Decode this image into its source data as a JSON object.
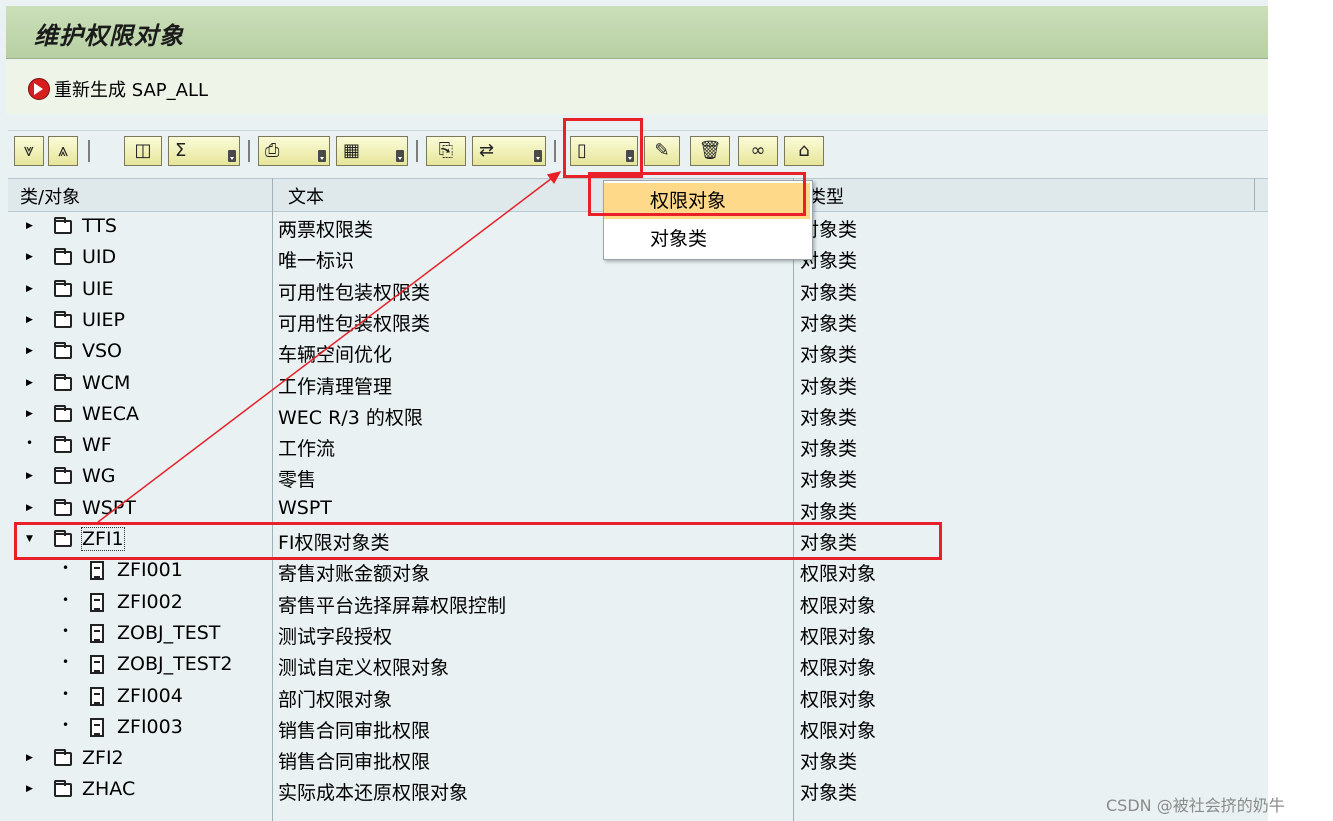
{
  "window": {
    "title": "维护权限对象"
  },
  "app_toolbar": {
    "regen_label": "重新生成 SAP_ALL"
  },
  "columns": {
    "object": "类/对象",
    "text": "文本",
    "type": "类型"
  },
  "dropdown": {
    "items": [
      {
        "label": "权限对象",
        "selected": true
      },
      {
        "label": "对象类",
        "selected": false
      }
    ]
  },
  "rows": [
    {
      "name": "TTS",
      "text": "两票权限类",
      "type": "对象类",
      "kind": "class",
      "toggle": "collapsed"
    },
    {
      "name": "UID",
      "text": "唯一标识",
      "type": "对象类",
      "kind": "class",
      "toggle": "collapsed"
    },
    {
      "name": "UIE",
      "text": "可用性包装权限类",
      "type": "对象类",
      "kind": "class",
      "toggle": "collapsed"
    },
    {
      "name": "UIEP",
      "text": "可用性包装权限类",
      "type": "对象类",
      "kind": "class",
      "toggle": "collapsed"
    },
    {
      "name": "VSO",
      "text": "车辆空间优化",
      "type": "对象类",
      "kind": "class",
      "toggle": "collapsed"
    },
    {
      "name": "WCM",
      "text": "工作清理管理",
      "type": "对象类",
      "kind": "class",
      "toggle": "collapsed"
    },
    {
      "name": "WECA",
      "text": "WEC R/3 的权限",
      "type": "对象类",
      "kind": "class",
      "toggle": "collapsed"
    },
    {
      "name": "WF",
      "text": "工作流",
      "type": "对象类",
      "kind": "class",
      "toggle": "leaf"
    },
    {
      "name": "WG",
      "text": "零售",
      "type": "对象类",
      "kind": "class",
      "toggle": "collapsed"
    },
    {
      "name": "WSPT",
      "text": "WSPT",
      "type": "对象类",
      "kind": "class",
      "toggle": "collapsed"
    },
    {
      "name": "ZFI1",
      "text": "FI权限对象类",
      "type": "对象类",
      "kind": "class",
      "toggle": "expanded"
    },
    {
      "name": "ZFI001",
      "text": "寄售对账金额对象",
      "type": "权限对象",
      "kind": "object",
      "toggle": "leaf"
    },
    {
      "name": "ZFI002",
      "text": "寄售平台选择屏幕权限控制",
      "type": "权限对象",
      "kind": "object",
      "toggle": "leaf"
    },
    {
      "name": "ZOBJ_TEST",
      "text": "测试字段授权",
      "type": "权限对象",
      "kind": "object",
      "toggle": "leaf"
    },
    {
      "name": "ZOBJ_TEST2",
      "text": "测试自定义权限对象",
      "type": "权限对象",
      "kind": "object",
      "toggle": "leaf"
    },
    {
      "name": "ZFI004",
      "text": "部门权限对象",
      "type": "权限对象",
      "kind": "object",
      "toggle": "leaf"
    },
    {
      "name": "ZFI003",
      "text": "销售合同审批权限",
      "type": "权限对象",
      "kind": "object",
      "toggle": "leaf"
    },
    {
      "name": "ZFI2",
      "text": "销售合同审批权限",
      "type": "对象类",
      "kind": "class",
      "toggle": "collapsed"
    },
    {
      "name": "ZHAC",
      "text": "实际成本还原权限对象",
      "type": "对象类",
      "kind": "class",
      "toggle": "collapsed"
    }
  ],
  "toolbar_icons": [
    "expand-all-icon",
    "collapse-all-icon",
    "find-icon",
    "sum-icon",
    "print-icon",
    "layout-icon",
    "print-preview-icon",
    "export-icon",
    "create-icon",
    "edit-icon",
    "delete-icon",
    "display-icon",
    "transport-icon"
  ],
  "watermark": "CSDN @被社会挤的奶牛"
}
